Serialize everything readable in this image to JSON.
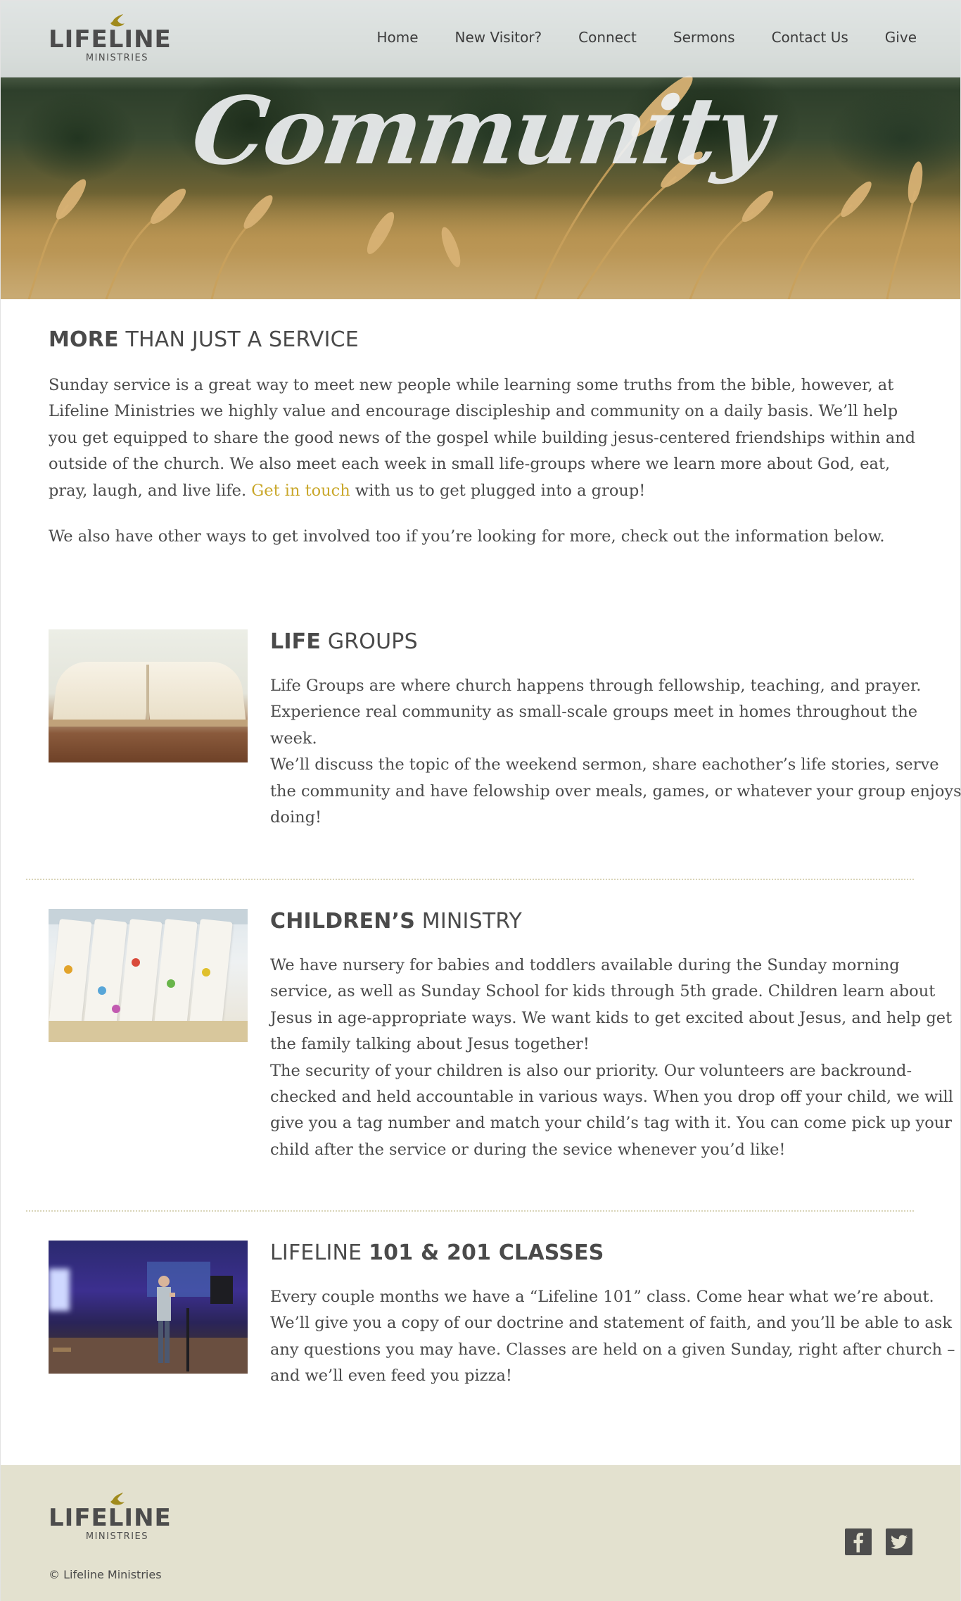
{
  "brand": {
    "name": "LIFELINE",
    "sub": "MINISTRIES",
    "accent_color": "#c9a72a"
  },
  "nav": [
    {
      "label": "Home"
    },
    {
      "label": "New Visitor?"
    },
    {
      "label": "Connect"
    },
    {
      "label": "Sermons"
    },
    {
      "label": "Contact Us"
    },
    {
      "label": "Give"
    }
  ],
  "hero": {
    "title": "Community"
  },
  "intro": {
    "heading_bold": "MORE",
    "heading_rest": " THAN JUST A SERVICE",
    "para1_before_link": "Sunday service is a great way to meet new people while learning some truths from the bible, however, at Lifeline Ministries we highly value and encourage discipleship and community on a daily basis. We’ll help you get equipped to share the good news of the gospel while building jesus-centered friendships within and outside of the church. We also meet each week in small life-groups where we learn more about God, eat, pray, laugh, and live life. ",
    "link": "Get in touch",
    "para1_after_link": " with us to get plugged into a group!",
    "para2": "We also have other ways to get involved too if you’re looking for more, check out the information below."
  },
  "sections": [
    {
      "heading_bold": "LIFE",
      "heading_rest": " GROUPS",
      "image": "open-bible-image",
      "paragraphs": [
        "Life Groups are where church happens through fellowship, teaching, and prayer. Experience real community as small-scale groups meet in homes throughout the week.",
        "We’ll discuss the topic of the weekend sermon, share eachother’s life stories, serve the community and have felowship over meals, games, or whatever your group enjoys doing!"
      ]
    },
    {
      "heading_bold": "CHILDREN’S",
      "heading_rest": " MINISTRY",
      "image": "handprint-shirts-image",
      "paragraphs": [
        "We have nursery for babies and toddlers available during the Sunday morning service, as well as Sunday School for kids through 5th grade. Children learn about Jesus in age-appropriate ways. We want kids to get excited about Jesus, and help get the family talking about Jesus together!",
        "The security of your children is also our priority. Our volunteers are backround-checked and held accountable in various ways. When you drop off your child, we will give you a tag number and match your child’s tag with it. You can come pick up your child after the service or during the sevice whenever you’d like!"
      ]
    },
    {
      "heading_pre": "LIFELINE ",
      "heading_bold": "101 & 201 CLASSES",
      "image": "speaker-on-stage-image",
      "paragraphs": [
        "Every couple months we have a “Lifeline 101” class. Come hear what we’re about. We’ll give you a copy of our doctrine and statement of faith, and you’ll be able to ask any questions you may have. Classes are held on a given Sunday, right after church – and we’ll even feed you pizza!"
      ]
    }
  ],
  "footer": {
    "copyright": "© Lifeline Ministries",
    "social": [
      {
        "icon": "facebook-icon"
      },
      {
        "icon": "twitter-icon"
      }
    ]
  }
}
